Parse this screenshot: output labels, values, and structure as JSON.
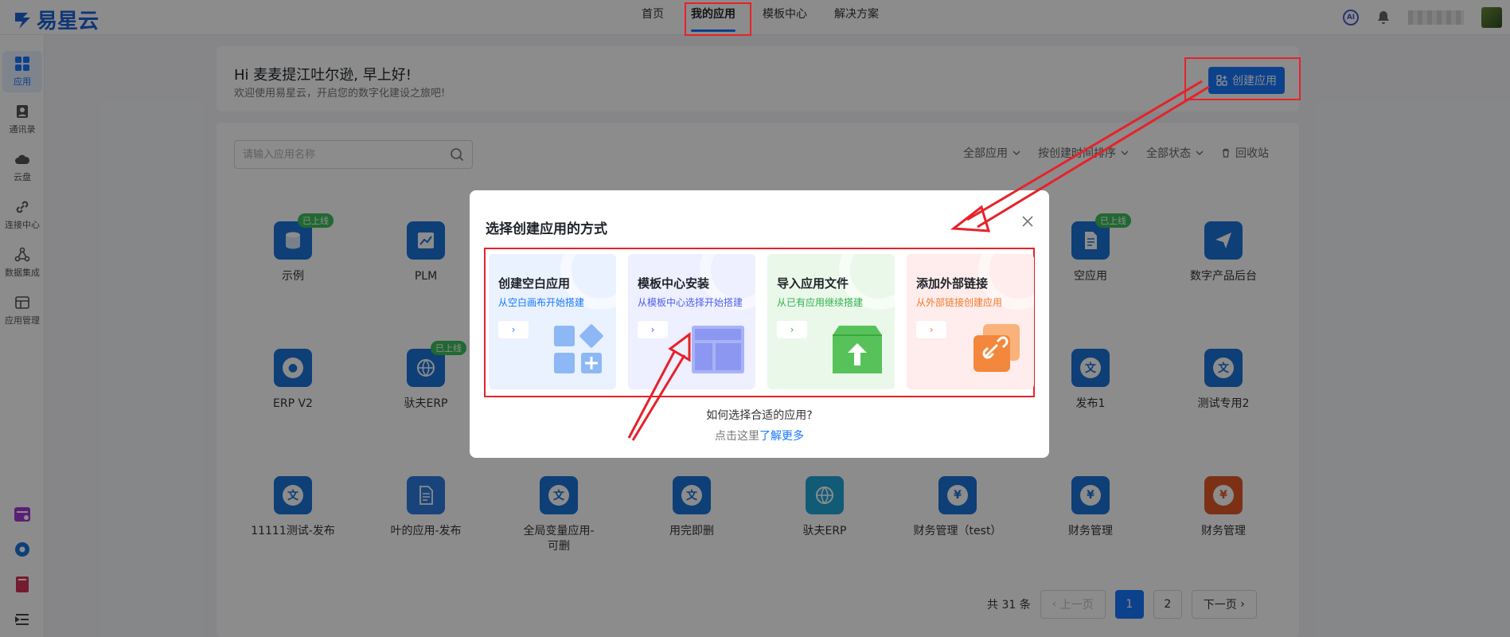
{
  "brand": {
    "name": "易星云"
  },
  "nav": [
    "首页",
    "我的应用",
    "模板中心",
    "解决方案"
  ],
  "top_right": {
    "ai_label": "AI"
  },
  "sidebar": [
    {
      "label": "应用",
      "icon": "grid-icon"
    },
    {
      "label": "通讯录",
      "icon": "contacts-icon"
    },
    {
      "label": "云盘",
      "icon": "cloud-icon"
    },
    {
      "label": "连接中心",
      "icon": "link-icon"
    },
    {
      "label": "数据集成",
      "icon": "data-integration-icon"
    },
    {
      "label": "应用管理",
      "icon": "app-manage-icon"
    }
  ],
  "welcome": {
    "title": "Hi 麦麦提江吐尔逊, 早上好!",
    "subtitle": "欢迎使用易星云，开启您的数字化建设之旅吧!"
  },
  "create_button": "创建应用",
  "search": {
    "placeholder": "请输入应用名称"
  },
  "filters": [
    "全部应用",
    "按创建时间排序",
    "全部状态",
    "回收站"
  ],
  "apps": [
    {
      "name": "示例",
      "badge": "已上线",
      "icon": "database-icon",
      "color": "#1a73d9"
    },
    {
      "name": "PLM",
      "badge": "",
      "icon": "chart-icon",
      "color": "#1a73d9"
    },
    {
      "name": "空应用",
      "badge": "已上线",
      "icon": "document-icon",
      "color": "#1a73d9"
    },
    {
      "name": "数字产品后台",
      "badge": "",
      "icon": "send-icon",
      "color": "#1a73d9"
    },
    {
      "name": "ERP V2",
      "badge": "",
      "icon": "globe-icon",
      "color": "#1a73d9"
    },
    {
      "name": "驮夫ERP",
      "badge": "已上线",
      "icon": "globe-icon",
      "color": "#1a73d9"
    },
    {
      "name": "发布1",
      "badge": "",
      "icon": "text-icon",
      "color": "#1a73d9"
    },
    {
      "name": "测试专用2",
      "badge": "",
      "icon": "text-icon",
      "color": "#1a73d9"
    },
    {
      "name": "11111测试-发布",
      "badge": "",
      "icon": "text-icon",
      "color": "#1a73d9"
    },
    {
      "name": "叶的应用-发布",
      "badge": "",
      "icon": "document-icon",
      "color": "#2f7ce0"
    },
    {
      "name": "全局变量应用-可删",
      "badge": "",
      "icon": "text-icon",
      "color": "#1a73d9"
    },
    {
      "name": "用完即删",
      "badge": "",
      "icon": "text-icon",
      "color": "#1a73d9"
    },
    {
      "name": "驮夫ERP",
      "badge": "",
      "icon": "globe-icon",
      "color": "#1fa6d9"
    },
    {
      "name": "财务管理（test）",
      "badge": "",
      "icon": "finance-icon",
      "color": "#1a73d9"
    },
    {
      "name": "财务管理",
      "badge": "",
      "icon": "finance-icon",
      "color": "#1a73d9"
    },
    {
      "name": "财务管理",
      "badge": "",
      "icon": "finance-icon",
      "color": "#e25a2b"
    }
  ],
  "pagination": {
    "total": "共 31 条",
    "prev": "上一页",
    "pages": [
      "1",
      "2"
    ],
    "next": "下一页"
  },
  "modal": {
    "title": "选择创建应用的方式",
    "cards": [
      {
        "title": "创建空白应用",
        "subtitle": "从空白画布开始搭建",
        "accent": "#1677ff",
        "bg": "#eaf2ff"
      },
      {
        "title": "模板中心安装",
        "subtitle": "从模板中心选择开始搭建",
        "accent": "#4a5df0",
        "bg": "#eeefff"
      },
      {
        "title": "导入应用文件",
        "subtitle": "从已有应用继续搭建",
        "accent": "#2fb24a",
        "bg": "#eaf8ea"
      },
      {
        "title": "添加外部链接",
        "subtitle": "从外部链接创建应用",
        "accent": "#f07a2a",
        "bg": "#ffecec"
      }
    ],
    "help_question": "如何选择合适的应用?",
    "help_prefix": "点击这里",
    "help_link": "了解更多"
  }
}
